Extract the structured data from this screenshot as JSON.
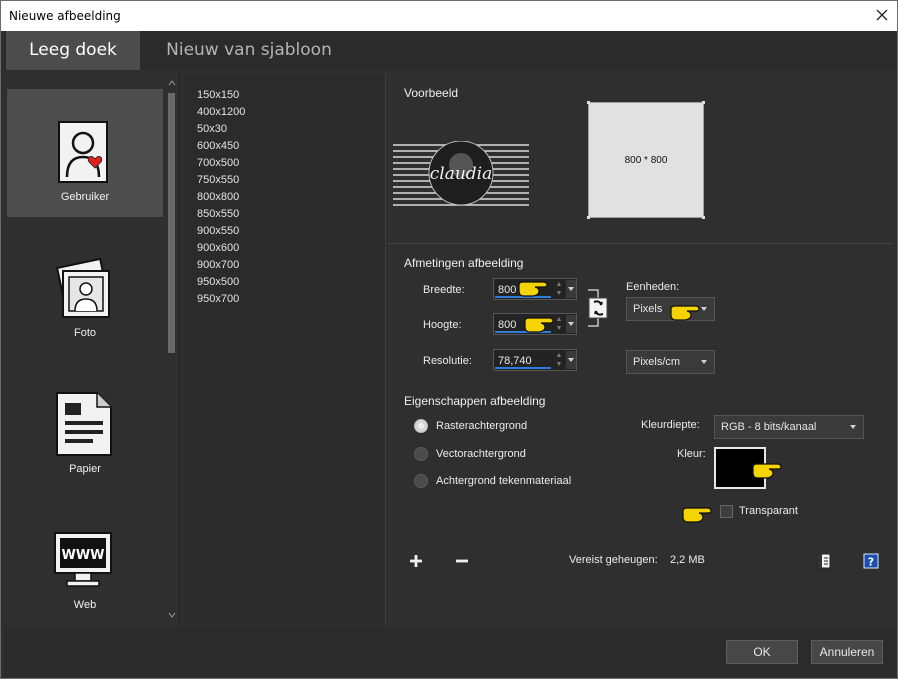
{
  "window": {
    "title": "Nieuwe afbeelding"
  },
  "tabs": [
    {
      "label": "Leeg doek",
      "active": true
    },
    {
      "label": "Nieuw van sjabloon",
      "active": false
    }
  ],
  "categories": [
    {
      "label": "Gebruiker",
      "icon": "user-icon",
      "selected": true
    },
    {
      "label": "Foto",
      "icon": "photo-icon",
      "selected": false
    },
    {
      "label": "Papier",
      "icon": "document-icon",
      "selected": false
    },
    {
      "label": "Web",
      "icon": "monitor-icon",
      "selected": false,
      "icon_text": "WWW"
    }
  ],
  "presets": [
    "150x150",
    "400x1200",
    "50x30",
    "600x450",
    "700x500",
    "750x550",
    "800x800",
    "850x550",
    "900x550",
    "900x600",
    "900x700",
    "950x500",
    "950x700"
  ],
  "preview": {
    "title": "Voorbeeld",
    "dimension_text": "800 * 800",
    "logo_text": "claudia"
  },
  "dimensions": {
    "title": "Afmetingen afbeelding",
    "width_label": "Breedte:",
    "width_value": "800",
    "height_label": "Hoogte:",
    "height_value": "800",
    "resolution_label": "Resolutie:",
    "resolution_value": "78,740",
    "units_label": "Eenheden:",
    "units_value": "Pixels",
    "resolution_unit": "Pixels/cm"
  },
  "properties": {
    "title": "Eigenschappen afbeelding",
    "options": [
      {
        "label": "Rasterachtergrond",
        "checked": true
      },
      {
        "label": "Vectorachtergrond",
        "checked": false
      },
      {
        "label": "Achtergrond tekenmateriaal",
        "checked": false
      }
    ],
    "color_depth_label": "Kleurdiepte:",
    "color_depth_value": "RGB - 8 bits/kanaal",
    "color_label": "Kleur:",
    "color_value": "#000000",
    "transparent_label": "Transparant",
    "transparent_checked": false
  },
  "footer": {
    "memory_label": "Vereist geheugen:",
    "memory_value": "2,2 MB",
    "ok_label": "OK",
    "cancel_label": "Annuleren"
  },
  "colors": {
    "accent_blue": "#2f7bd8",
    "pointer_yellow": "#f5d400",
    "panel": "#2f2f2f"
  }
}
